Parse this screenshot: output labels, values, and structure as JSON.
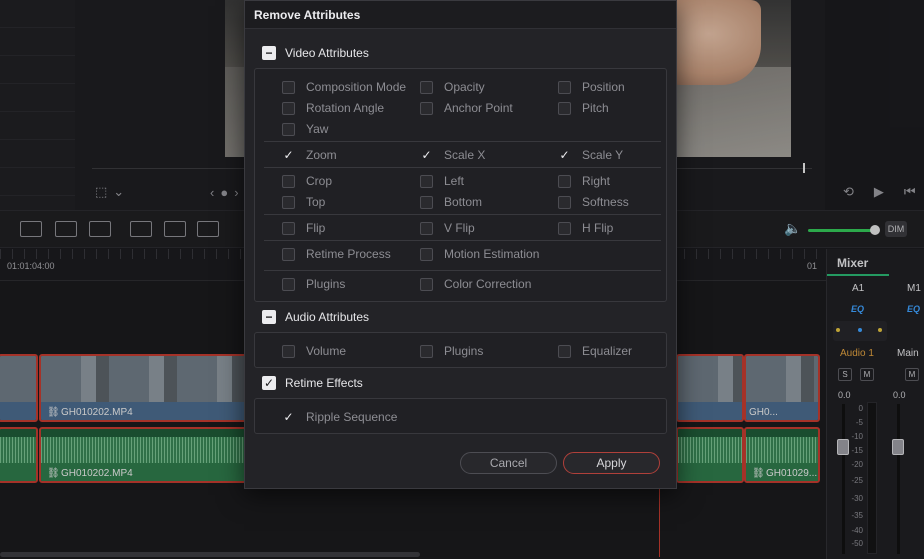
{
  "dialog": {
    "title": "Remove Attributes",
    "video_section": {
      "label": "Video Attributes",
      "rows": [
        [
          {
            "label": "Composition Mode",
            "checked": false
          },
          {
            "label": "Opacity",
            "checked": false
          },
          {
            "label": "Position",
            "checked": false
          }
        ],
        [
          {
            "label": "Rotation Angle",
            "checked": false
          },
          {
            "label": "Anchor Point",
            "checked": false
          },
          {
            "label": "Pitch",
            "checked": false
          }
        ],
        [
          {
            "label": "Yaw",
            "checked": false
          }
        ],
        [
          {
            "label": "Zoom",
            "checked": true
          },
          {
            "label": "Scale X",
            "checked": true
          },
          {
            "label": "Scale Y",
            "checked": true
          }
        ],
        [
          {
            "label": "Crop",
            "checked": false
          },
          {
            "label": "Left",
            "checked": false
          },
          {
            "label": "Right",
            "checked": false
          }
        ],
        [
          {
            "label": "Top",
            "checked": false
          },
          {
            "label": "Bottom",
            "checked": false
          },
          {
            "label": "Softness",
            "checked": false
          }
        ],
        [
          {
            "label": "Flip",
            "checked": false
          },
          {
            "label": "V Flip",
            "checked": false
          },
          {
            "label": "H Flip",
            "checked": false
          }
        ],
        [
          {
            "label": "Retime Process",
            "checked": false
          },
          {
            "label": "Motion Estimation",
            "checked": false
          }
        ],
        [
          {
            "label": "Plugins",
            "checked": false
          },
          {
            "label": "Color Correction",
            "checked": false
          }
        ]
      ]
    },
    "audio_section": {
      "label": "Audio Attributes",
      "rows": [
        [
          {
            "label": "Volume",
            "checked": false
          },
          {
            "label": "Plugins",
            "checked": false
          },
          {
            "label": "Equalizer",
            "checked": false
          }
        ]
      ]
    },
    "retime_section": {
      "label": "Retime Effects",
      "checked": true,
      "rows": [
        [
          {
            "label": "Ripple Sequence",
            "checked": true
          }
        ]
      ]
    },
    "cancel_label": "Cancel",
    "apply_label": "Apply"
  },
  "timeline": {
    "timecode_left": "01:01:04:00",
    "timecode_right": "01",
    "clips": {
      "video_main": "GH010202.MP4",
      "video_right": "GH0...",
      "audio_main": "GH010202.MP4",
      "audio_right": "GH01029..."
    }
  },
  "mixer": {
    "title": "Mixer",
    "channels": [
      {
        "label": "A1",
        "eq": "EQ",
        "track": "Audio 1",
        "level": "0.0",
        "track_color": "#e0a040"
      },
      {
        "label": "M1",
        "eq": "EQ",
        "track": "Main",
        "level": "0.0",
        "track_color": "#e3e3e6"
      }
    ],
    "scale": [
      "0",
      "-5",
      "-10",
      "-15",
      "-20",
      "-25",
      "-30",
      "-35",
      "-40",
      "-50"
    ]
  },
  "viewer": {
    "dim_label": "DIM"
  },
  "colors": {
    "accent_red": "#c23b2f",
    "accent_green": "#34c759",
    "eq_blue": "#3fa2ff"
  }
}
